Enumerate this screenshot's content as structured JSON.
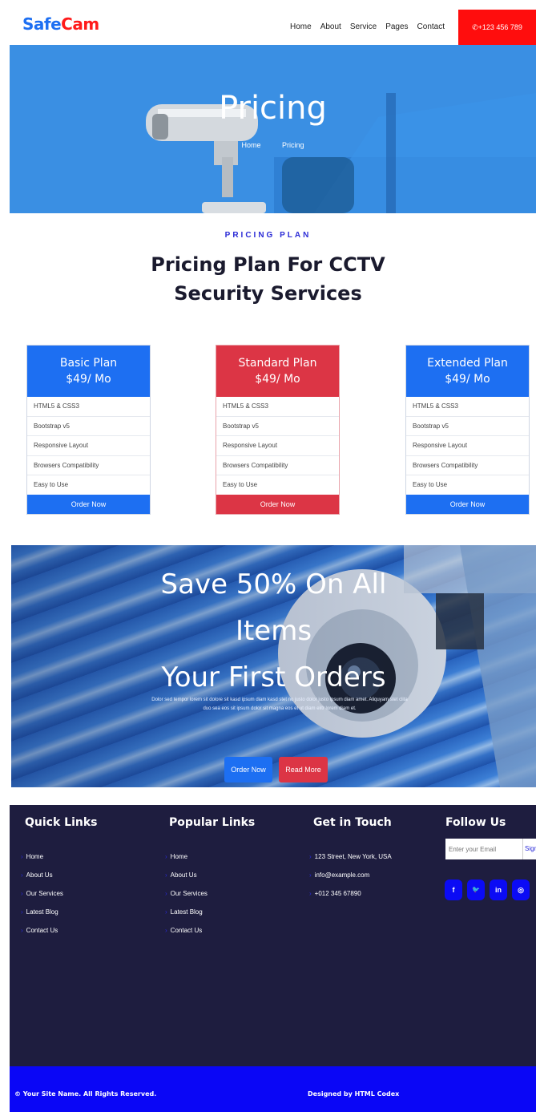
{
  "brand": {
    "part1": "Safe",
    "part2": "Cam"
  },
  "nav": {
    "items": [
      "Home",
      "About",
      "Service",
      "Pages",
      "Contact"
    ],
    "phone": "✆+123 456 789"
  },
  "hero": {
    "title": "Pricing",
    "breadcrumb": [
      "Home",
      "Pricing"
    ]
  },
  "pricing": {
    "tag": "PRICING PLAN",
    "title_line1": "Pricing Plan For CCTV",
    "title_line2": "Security Services",
    "plans": [
      {
        "name": "Basic Plan",
        "price": "$49/ Mo",
        "color": "#1d6ff2",
        "features": [
          "HTML5 & CSS3",
          "Bootstrap v5",
          "Responsive Layout",
          "Browsers Compatibility",
          "Easy to Use"
        ],
        "button": "Order Now"
      },
      {
        "name": "Standard Plan",
        "price": "$49/ Mo",
        "color": "#dc3545",
        "features": [
          "HTML5 & CSS3",
          "Bootstrap v5",
          "Responsive Layout",
          "Browsers Compatibility",
          "Easy to Use"
        ],
        "button": "Order Now"
      },
      {
        "name": "Extended Plan",
        "price": "$49/ Mo",
        "color": "#1d6ff2",
        "features": [
          "HTML5 & CSS3",
          "Bootstrap v5",
          "Responsive Layout",
          "Browsers Compatibility",
          "Easy to Use"
        ],
        "button": "Order Now"
      }
    ]
  },
  "promo": {
    "line1": "Save 50% On All",
    "line2": "Items",
    "line3": "Your First Orders",
    "text": "Dolor sed tempor lorem sit dolore sit kasd ipsum diam kasd stet no justo dolor justo ipsum diam amet. Aliquyam stet clita duo sea eos sit ipsum dolor sit magna eos et ut diam elitr lorem diam et.",
    "btn_primary": "Order Now",
    "btn_secondary": "Read More"
  },
  "footer": {
    "quick_title": "Quick Links",
    "quick_links": [
      "Home",
      "About Us",
      "Our Services",
      "Latest Blog",
      "Contact Us"
    ],
    "popular_title": "Popular Links",
    "popular_links": [
      "Home",
      "About Us",
      "Our Services",
      "Latest Blog",
      "Contact Us"
    ],
    "contact_title": "Get in Touch",
    "contact_items": [
      "123 Street, New York, USA",
      "info@example.com",
      "+012 345 67890"
    ],
    "follow_title": "Follow Us",
    "email_placeholder": "Enter your Email",
    "email_button": "Sign Up",
    "social": [
      {
        "icon": "facebook-icon",
        "glyph": "f"
      },
      {
        "icon": "twitter-icon",
        "glyph": "🐦"
      },
      {
        "icon": "linkedin-icon",
        "glyph": "in"
      },
      {
        "icon": "instagram-icon",
        "glyph": "◎"
      }
    ],
    "copyright": "© Your Site Name. All Rights Reserved.",
    "designed_by": "Designed by HTML Codex"
  }
}
